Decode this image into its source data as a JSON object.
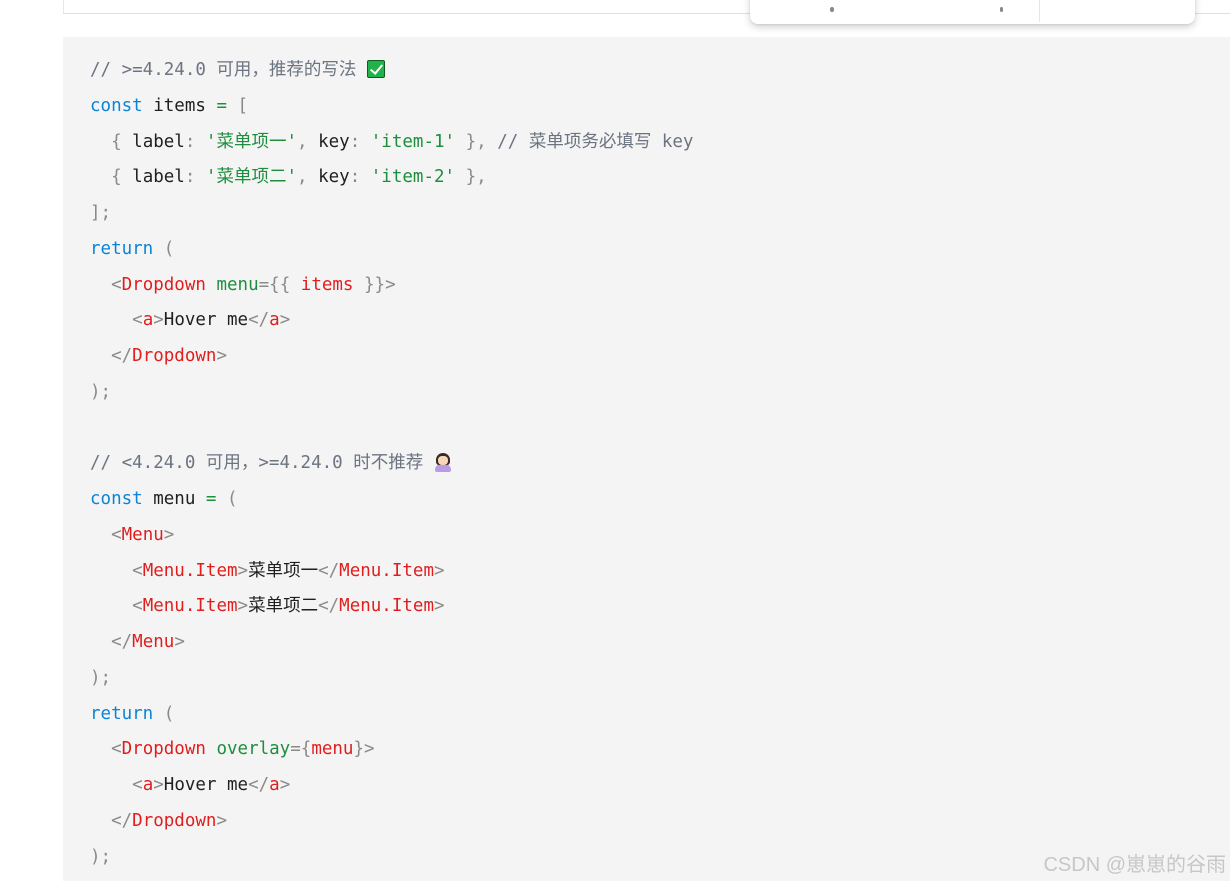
{
  "code": {
    "line1": {
      "comment": "// >=4.24.0 可用，推荐的写法 ",
      "emoji": "white-heavy-check-mark-icon"
    },
    "line2": {
      "kw": "const",
      "name": " items ",
      "eq": "=",
      "bracket": " ["
    },
    "line3": {
      "indent": "  ",
      "open": "{ ",
      "key1": "label",
      "colon1": ": ",
      "val1": "'菜单项一'",
      "comma1": ", ",
      "key2": "key",
      "colon2": ": ",
      "val2": "'item-1'",
      "close": " },",
      "comment": " // 菜单项务必填写 key"
    },
    "line4": {
      "indent": "  ",
      "open": "{ ",
      "key1": "label",
      "colon1": ": ",
      "val1": "'菜单项二'",
      "comma1": ", ",
      "key2": "key",
      "colon2": ": ",
      "val2": "'item-2'",
      "close": " },"
    },
    "line5": {
      "text": "];"
    },
    "line6": {
      "kw": "return",
      "paren": " ("
    },
    "line7": {
      "indent": "  ",
      "lt": "<",
      "tag": "Dropdown",
      "sp": " ",
      "attr": "menu",
      "eq": "={{ ",
      "expr": "items",
      "end": " }}>"
    },
    "line8": {
      "indent": "    ",
      "lt": "<",
      "tag": "a",
      "gt": ">",
      "text": "Hover me",
      "lt2": "</",
      "tag2": "a",
      "gt2": ">"
    },
    "line9": {
      "indent": "  ",
      "lt": "</",
      "tag": "Dropdown",
      "gt": ">"
    },
    "line10": {
      "text": ");"
    },
    "line11": {
      "text": ""
    },
    "line12": {
      "comment": "// <4.24.0 可用，>=4.24.0 时不推荐 ",
      "emoji": "person-gesturing-no-icon"
    },
    "line13": {
      "kw": "const",
      "name": " menu ",
      "eq": "=",
      "paren": " ("
    },
    "line14": {
      "indent": "  ",
      "lt": "<",
      "tag": "Menu",
      "gt": ">"
    },
    "line15": {
      "indent": "    ",
      "lt": "<",
      "tag": "Menu.Item",
      "gt": ">",
      "text": "菜单项一",
      "lt2": "</",
      "tag2": "Menu.Item",
      "gt2": ">"
    },
    "line16": {
      "indent": "    ",
      "lt": "<",
      "tag": "Menu.Item",
      "gt": ">",
      "text": "菜单项二",
      "lt2": "</",
      "tag2": "Menu.Item",
      "gt2": ">"
    },
    "line17": {
      "indent": "  ",
      "lt": "</",
      "tag": "Menu",
      "gt": ">"
    },
    "line18": {
      "text": ");"
    },
    "line19": {
      "kw": "return",
      "paren": " ("
    },
    "line20": {
      "indent": "  ",
      "lt": "<",
      "tag": "Dropdown",
      "sp": " ",
      "attr": "overlay",
      "eq": "={",
      "expr": "menu",
      "end": "}>"
    },
    "line21": {
      "indent": "    ",
      "lt": "<",
      "tag": "a",
      "gt": ">",
      "text": "Hover me",
      "lt2": "</",
      "tag2": "a",
      "gt2": ">"
    },
    "line22": {
      "indent": "  ",
      "lt": "</",
      "tag": "Dropdown",
      "gt": ">"
    },
    "line23": {
      "text": ");"
    }
  },
  "watermark": "CSDN @崽崽的谷雨",
  "colors": {
    "code_bg": "#f4f4f4",
    "comment": "#6b7480",
    "keyword": "#0a84d8",
    "string": "#1e8e3e",
    "tag": "#e01e1e"
  }
}
